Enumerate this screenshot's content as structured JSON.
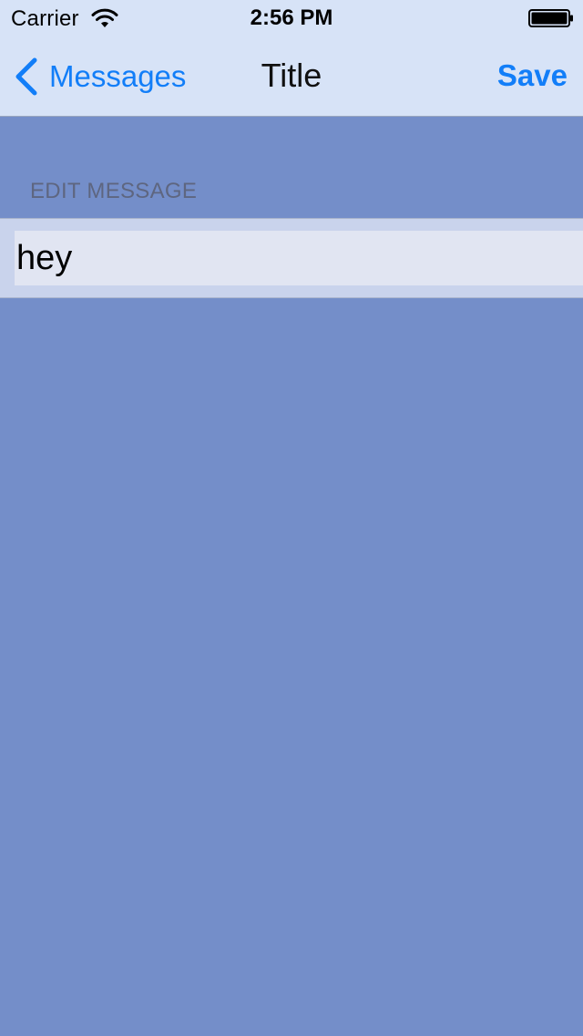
{
  "status_bar": {
    "carrier": "Carrier",
    "time": "2:56 PM",
    "wifi_icon": "wifi-icon",
    "battery_icon": "battery-icon"
  },
  "nav_bar": {
    "back_label": "Messages",
    "back_icon": "chevron-left-icon",
    "title": "Title",
    "save_label": "Save"
  },
  "form": {
    "section_header": "EDIT MESSAGE",
    "message_value": "hey"
  },
  "colors": {
    "accent": "#127ef8",
    "background": "#748ec9",
    "nav_background": "#d7e3f7",
    "field_background": "#e1e5f2"
  }
}
